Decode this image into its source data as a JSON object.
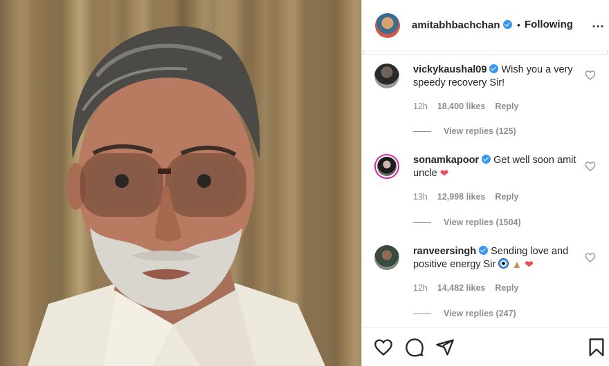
{
  "post": {
    "username": "amitabhbachchan",
    "separator": "•",
    "follow_status": "Following",
    "more_icon": "⋯"
  },
  "comments": [
    {
      "username": "vickykaushal09",
      "text": "Wish you a very speedy recovery Sir!",
      "time": "12h",
      "likes": "18,400 likes",
      "reply": "Reply",
      "view_replies": "View replies (125)"
    },
    {
      "username": "sonamkapoor",
      "text": "Get well soon amit uncle",
      "time": "13h",
      "likes": "12,998 likes",
      "reply": "Reply",
      "view_replies": "View replies (1504)"
    },
    {
      "username": "ranveersingh",
      "text": "Sending love and positive energy Sir",
      "time": "12h",
      "likes": "14,482 likes",
      "reply": "Reply",
      "view_replies": "View replies (247)"
    }
  ],
  "icons": {
    "like": "heart-icon",
    "comment": "comment-icon",
    "share": "send-icon",
    "save": "bookmark-icon"
  },
  "colors": {
    "verified": "#3897f0",
    "heart_emoji": "#ed4956",
    "meta_text": "#8e8e8e"
  }
}
